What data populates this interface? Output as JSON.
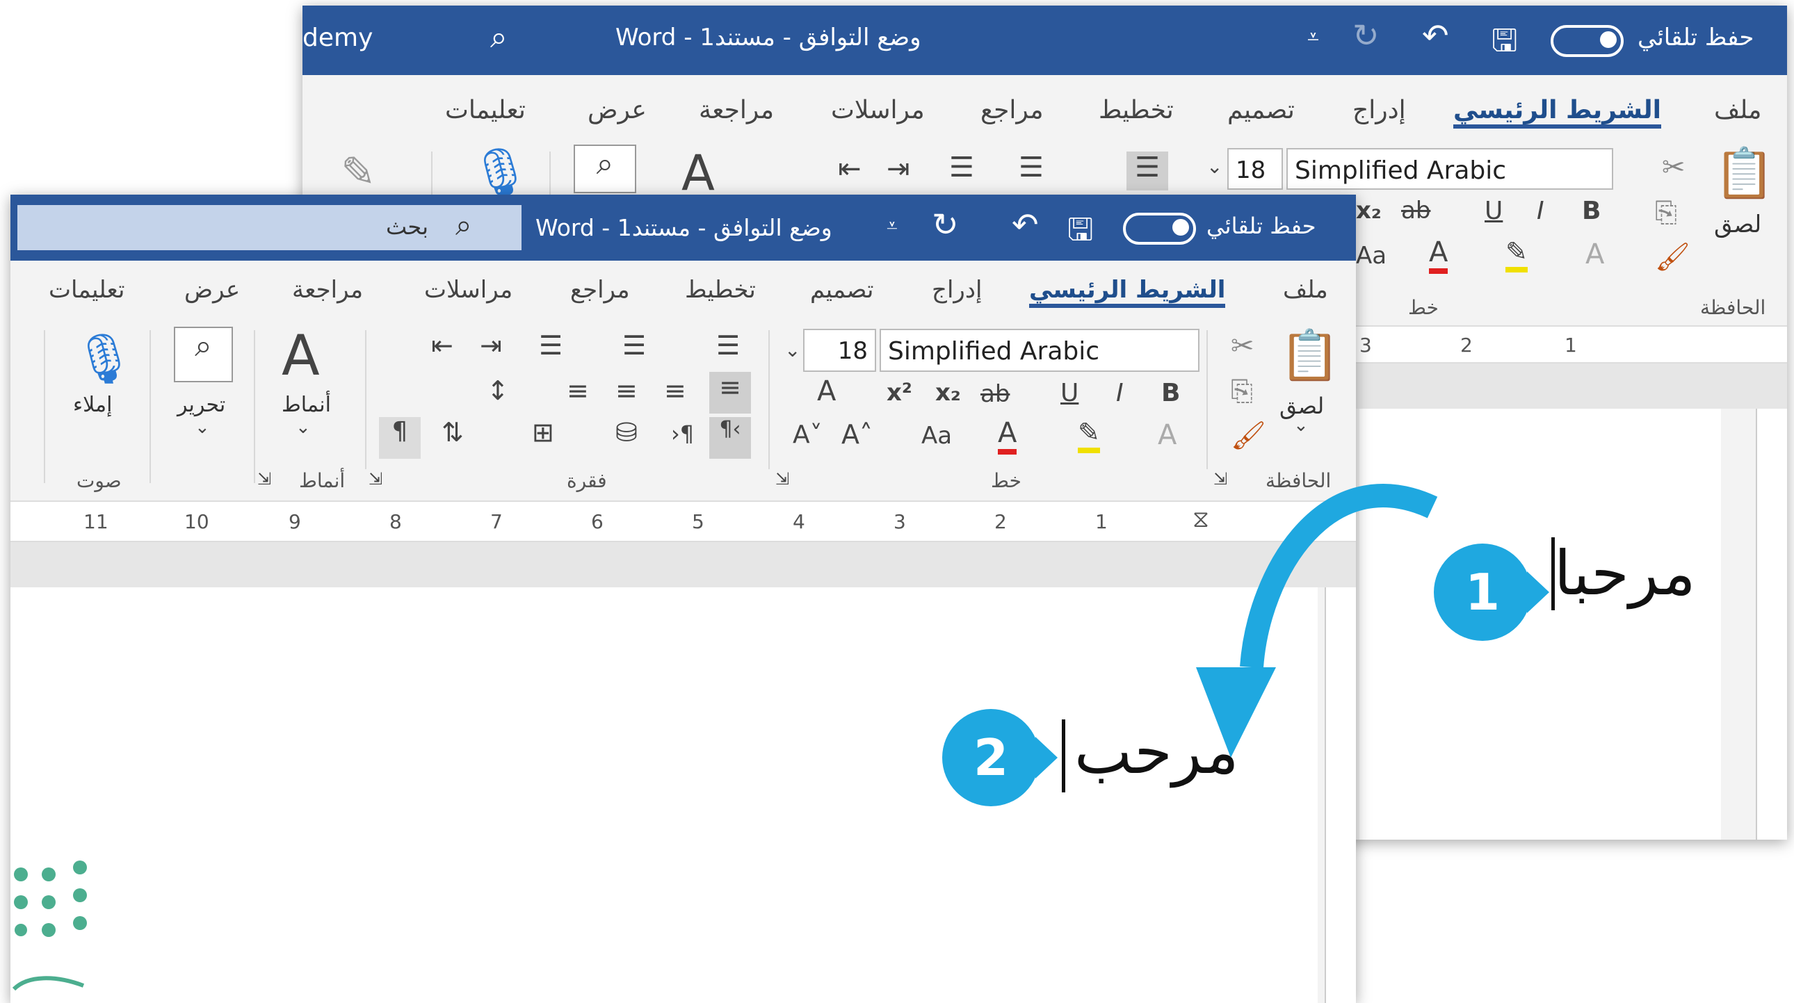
{
  "back_window": {
    "title_left": "demy",
    "title": "Word  -  وضع التوافق  -  مستند1",
    "autosave_label": "حفظ تلقائي",
    "tabs": [
      "ملف",
      "الشريط الرئيسي",
      "إدراج",
      "تصميم",
      "تخطيط",
      "مراجع",
      "مراسلات",
      "مراجعة",
      "عرض",
      "تعليمات"
    ],
    "active_tab": "الشريط الرئيسي",
    "font_name": "Simplified Arabic",
    "font_size": "18",
    "paste_label": "لصق",
    "group_clipboard": "الحافظة",
    "group_font": "خط",
    "bold": "B",
    "italic": "I",
    "underline": "U",
    "strike": "ab",
    "ruler": [
      "3",
      "2",
      "1"
    ],
    "doc_text": "مرحبا"
  },
  "front_window": {
    "search_placeholder": "بحث",
    "title": "Word  -  وضع التوافق  -  مستند1",
    "autosave_label": "حفظ تلقائي",
    "tabs": [
      "ملف",
      "الشريط الرئيسي",
      "إدراج",
      "تصميم",
      "تخطيط",
      "مراجع",
      "مراسلات",
      "مراجعة",
      "عرض",
      "تعليمات"
    ],
    "active_tab": "الشريط الرئيسي",
    "font_name": "Simplified Arabic",
    "font_size": "18",
    "paste_label": "لصق",
    "styles_label": "أنماط",
    "edit_label": "تحرير",
    "dictate_label": "إملاء",
    "group_clipboard": "الحافظة",
    "group_font": "خط",
    "group_paragraph": "فقرة",
    "group_styles": "أنماط",
    "group_voice": "صوت",
    "bold": "B",
    "italic": "I",
    "underline": "U",
    "strike": "ab",
    "subscript": "x₂",
    "superscript": "x²",
    "change_case": "Aa",
    "grow_font": "A˄",
    "shrink_font": "A˅",
    "ruler": [
      "11",
      "10",
      "9",
      "8",
      "7",
      "6",
      "5",
      "4",
      "3",
      "2",
      "1"
    ],
    "doc_text": "مرحب"
  },
  "badges": [
    "1",
    "2"
  ],
  "colors": {
    "accent": "#2b579a",
    "badge": "#1fa8e0",
    "arrow": "#1fa8e0"
  }
}
